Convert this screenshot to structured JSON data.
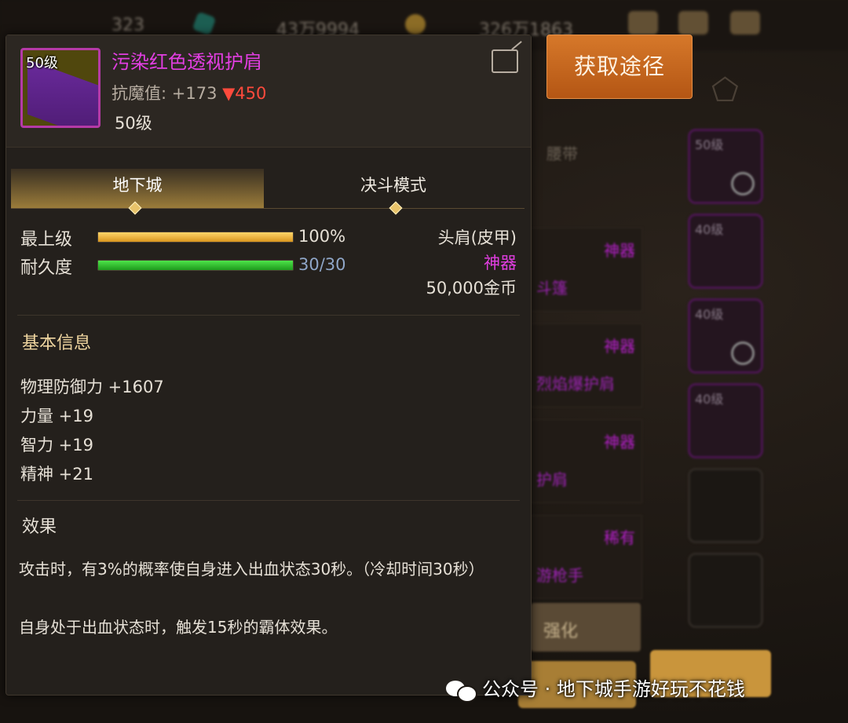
{
  "topbar": {
    "res1": "323",
    "res2": "43万9994",
    "res3": "326万1863"
  },
  "get_source_label": "获取途径",
  "inventory": {
    "tab": "腰带",
    "rows": [
      {
        "tag": "神器",
        "name": "斗篷"
      },
      {
        "tag": "神器",
        "name": "烈焰爆护肩"
      },
      {
        "tag": "神器",
        "name": "护肩"
      },
      {
        "tag": "稀有",
        "name": "游枪手"
      }
    ],
    "button": "强化",
    "slots": [
      "50级",
      "40级",
      "40级",
      "40级"
    ]
  },
  "item": {
    "icon_level": "50级",
    "name": "污染红色透视护肩",
    "stat_label": "抗魔值:",
    "stat_value": "+173",
    "stat_diff": "▼450",
    "level": "50级",
    "name_color": "#e23ee2"
  },
  "tabs": {
    "active": "地下城",
    "inactive": "决斗模式"
  },
  "bars": {
    "exp_label": "最上级",
    "exp_value": "100%",
    "exp_fraction": 1.0,
    "dur_label": "耐久度",
    "dur_value": "30/30",
    "dur_fraction": 1.0
  },
  "info": {
    "slot_type": "头肩(皮甲)",
    "rarity": "神器",
    "price": "50,000金币"
  },
  "basic": {
    "title": "基本信息",
    "attrs": [
      "物理防御力 +1607",
      "力量 +19",
      "智力 +19",
      "精神 +21"
    ]
  },
  "effect": {
    "title": "效果",
    "line1": "攻击时，有3%的概率使自身进入出血状态30秒。（冷却时间30秒）",
    "line2": "自身处于出血状态时，触发15秒的霸体效果。"
  },
  "watermark": "公众号 · 地下城手游好玩不花钱"
}
